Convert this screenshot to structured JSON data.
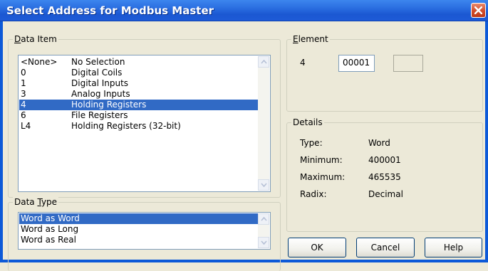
{
  "window": {
    "title": "Select Address for Modbus Master",
    "close_icon": "close-icon"
  },
  "data_item": {
    "legend": "Data Item",
    "items": [
      {
        "code": "<None>",
        "name": "No Selection"
      },
      {
        "code": "0",
        "name": "Digital Coils"
      },
      {
        "code": "1",
        "name": "Digital Inputs"
      },
      {
        "code": "3",
        "name": "Analog Inputs"
      },
      {
        "code": "4",
        "name": "Holding Registers"
      },
      {
        "code": "6",
        "name": "File Registers"
      },
      {
        "code": "L4",
        "name": "Holding Registers (32-bit)"
      }
    ],
    "selected_index": 4
  },
  "data_type": {
    "legend": "Data Type",
    "items": [
      "Word as Word",
      "Word as Long",
      "Word as Real"
    ],
    "selected_index": 0
  },
  "element": {
    "legend": "Element",
    "prefix": "4",
    "value": "00001",
    "extra_value": ""
  },
  "details": {
    "legend": "Details",
    "rows": [
      {
        "label": "Type:",
        "value": "Word"
      },
      {
        "label": "Minimum:",
        "value": "400001"
      },
      {
        "label": "Maximum:",
        "value": "465535"
      },
      {
        "label": "Radix:",
        "value": "Decimal"
      }
    ]
  },
  "buttons": {
    "ok": "OK",
    "cancel": "Cancel",
    "help": "Help"
  },
  "colors": {
    "title_bar": "#2a6de0",
    "selection": "#316ac5",
    "dialog_bg": "#ece9d8"
  }
}
